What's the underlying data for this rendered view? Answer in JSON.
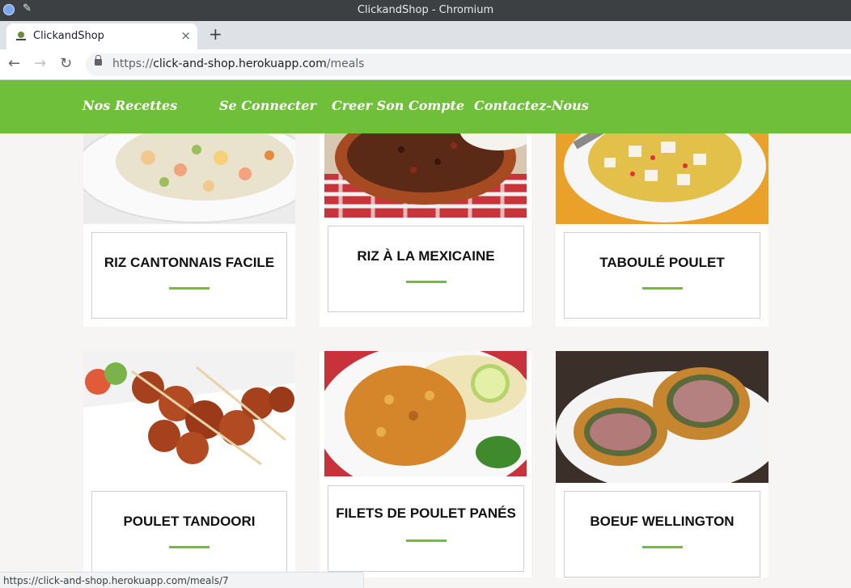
{
  "window": {
    "title": "ClickandShop - Chromium"
  },
  "tab": {
    "title": "ClickandShop",
    "close": "×",
    "new_tab": "+"
  },
  "address": {
    "scheme": "https://",
    "host": "click-and-shop.herokuapp.com",
    "path": "/meals"
  },
  "nav": {
    "items": [
      "Nos Recettes",
      "Se Connecter",
      "Creer Son Compte",
      "Contactez-Nous"
    ]
  },
  "meals": [
    {
      "name": "RIZ CANTONNAIS FACILE",
      "image": "fried-rice-plate"
    },
    {
      "name": "RIZ À LA MEXICAINE",
      "image": "chili-bean-rice-bowl"
    },
    {
      "name": "TABOULÉ POULET",
      "image": "chicken-couscous-plate"
    },
    {
      "name": "POULET TANDOORI",
      "image": "tandoori-skewers"
    },
    {
      "name": "FILETS DE POULET PANÉS",
      "image": "breaded-chicken-tagliatelle"
    },
    {
      "name": "BOEUF WELLINGTON",
      "image": "beef-wellington-slices"
    }
  ],
  "status": {
    "url": "https://click-and-shop.herokuapp.com/meals/7"
  },
  "colors": {
    "brand_green": "#70bf3b",
    "chrome_dark": "#3c4043"
  }
}
